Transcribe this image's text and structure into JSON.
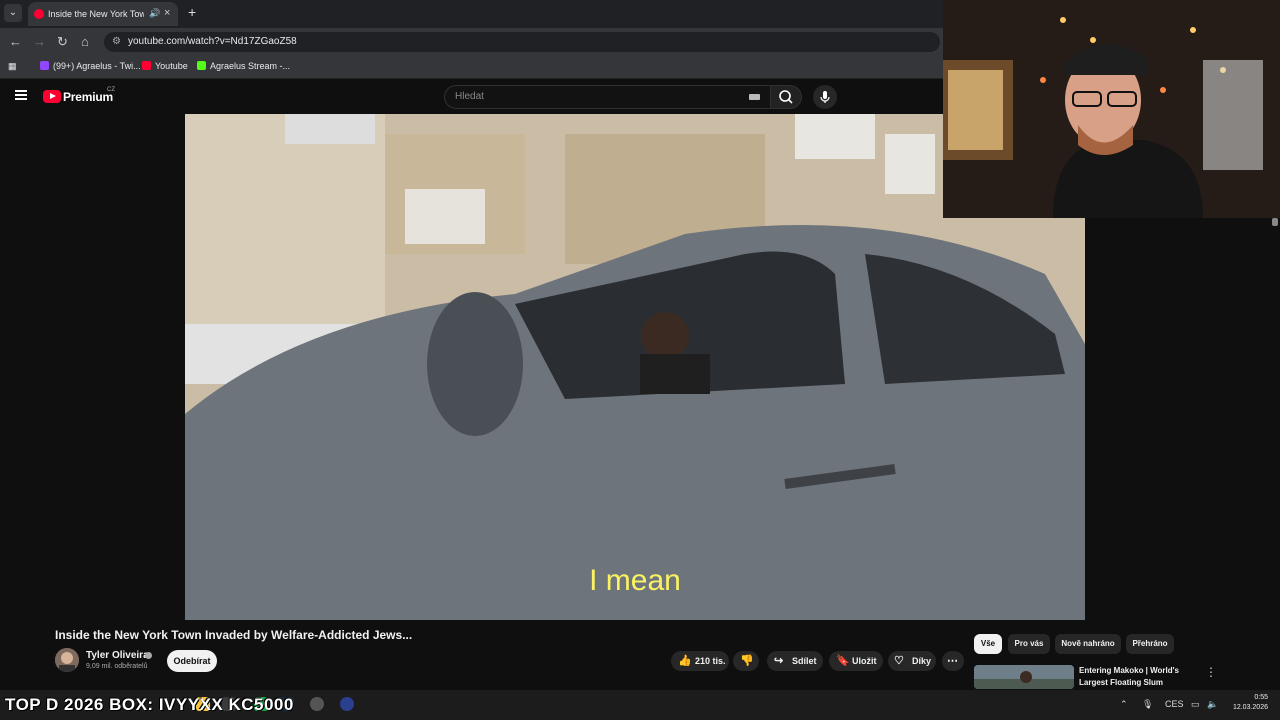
{
  "browser": {
    "tab_title": "Inside the New York Town I",
    "url": "youtube.com/watch?v=Nd17ZGaoZ58",
    "bookmarks": [
      {
        "label": "(99+) Agraelus - Twi...",
        "color": "#9146ff"
      },
      {
        "label": "Youtube",
        "color": "#ff0033"
      },
      {
        "label": "Agraelus Stream -...",
        "color": "#53fc18"
      }
    ]
  },
  "masthead": {
    "logo_text": "Premium",
    "country": "CZ",
    "search_placeholder": "Hledat"
  },
  "video": {
    "caption": "I mean",
    "title": "Inside the New York Town Invaded by Welfare-Addicted Jews...",
    "channel": "Tyler Oliveira",
    "subscribers": "9,09 mil. odběratelů",
    "subscribe_label": "Odebírat",
    "like_count": "210 tis.",
    "share_label": "Sdílet",
    "save_label": "Uložit",
    "thanks_label": "Díky"
  },
  "sidebar": {
    "chips": [
      "Vše",
      "Pro vás",
      "Nově nahráno",
      "Přehráno"
    ],
    "recommendation_title": "Entering Makoko | World's Largest Floating Slum"
  },
  "taskbar": {
    "overlay": "TOP D 2026 BOX: IVYYXX  KC5000",
    "lang": "CES",
    "time": "0:55",
    "date": "12.03.2026"
  },
  "colors": {
    "caption": "#fbf263",
    "youtube_red": "#ff0033",
    "background": "#0f0f0f"
  }
}
